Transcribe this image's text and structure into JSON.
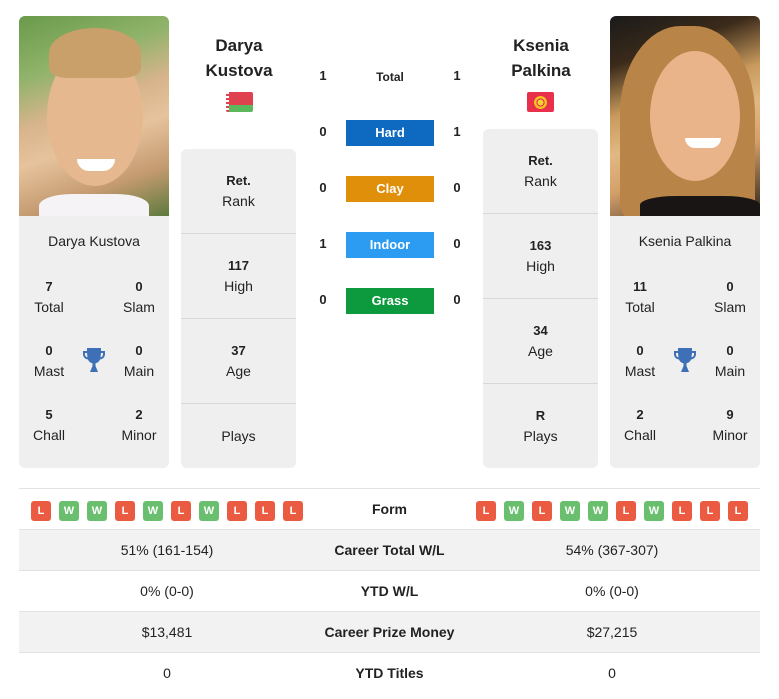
{
  "colors": {
    "hard": "#0d6ac0",
    "clay": "#e08f0a",
    "indoor": "#2b9cf2",
    "grass": "#0d9a3e",
    "win": "#6abf6f",
    "loss": "#ea5b42",
    "trophy": "#3e70b8"
  },
  "player1": {
    "name_line1": "Darya",
    "name_line2": "Kustova",
    "full_name": "Darya Kustova",
    "flag": "belarus-flag",
    "titles": {
      "total": "7",
      "total_label": "Total",
      "slam": "0",
      "slam_label": "Slam",
      "mast": "0",
      "mast_label": "Mast",
      "main": "0",
      "main_label": "Main",
      "chall": "5",
      "chall_label": "Chall",
      "minor": "2",
      "minor_label": "Minor"
    },
    "rank": "Ret.",
    "rank_label": "Rank",
    "high": "117",
    "high_label": "High",
    "age": "37",
    "age_label": "Age",
    "plays": "",
    "plays_label": "Plays",
    "form": [
      "L",
      "W",
      "W",
      "L",
      "W",
      "L",
      "W",
      "L",
      "L",
      "L"
    ]
  },
  "player2": {
    "name_line1": "Ksenia",
    "name_line2": "Palkina",
    "full_name": "Ksenia Palkina",
    "flag": "kyrgyzstan-flag",
    "titles": {
      "total": "11",
      "total_label": "Total",
      "slam": "0",
      "slam_label": "Slam",
      "mast": "0",
      "mast_label": "Mast",
      "main": "0",
      "main_label": "Main",
      "chall": "2",
      "chall_label": "Chall",
      "minor": "9",
      "minor_label": "Minor"
    },
    "rank": "Ret.",
    "rank_label": "Rank",
    "high": "163",
    "high_label": "High",
    "age": "34",
    "age_label": "Age",
    "plays": "R",
    "plays_label": "Plays",
    "form": [
      "L",
      "W",
      "L",
      "W",
      "W",
      "L",
      "W",
      "L",
      "L",
      "L"
    ]
  },
  "h2h": {
    "total_label": "Total",
    "total_p1": "1",
    "total_p2": "1",
    "hard_label": "Hard",
    "hard_p1": "0",
    "hard_p2": "1",
    "clay_label": "Clay",
    "clay_p1": "0",
    "clay_p2": "0",
    "indoor_label": "Indoor",
    "indoor_p1": "1",
    "indoor_p2": "0",
    "grass_label": "Grass",
    "grass_p1": "0",
    "grass_p2": "0"
  },
  "table": {
    "form_label": "Form",
    "rows": [
      {
        "label": "Career Total W/L",
        "p1": "51% (161-154)",
        "p2": "54% (367-307)"
      },
      {
        "label": "YTD W/L",
        "p1": "0% (0-0)",
        "p2": "0% (0-0)"
      },
      {
        "label": "Career Prize Money",
        "p1": "$13,481",
        "p2": "$27,215"
      },
      {
        "label": "YTD Titles",
        "p1": "0",
        "p2": "0"
      }
    ]
  }
}
